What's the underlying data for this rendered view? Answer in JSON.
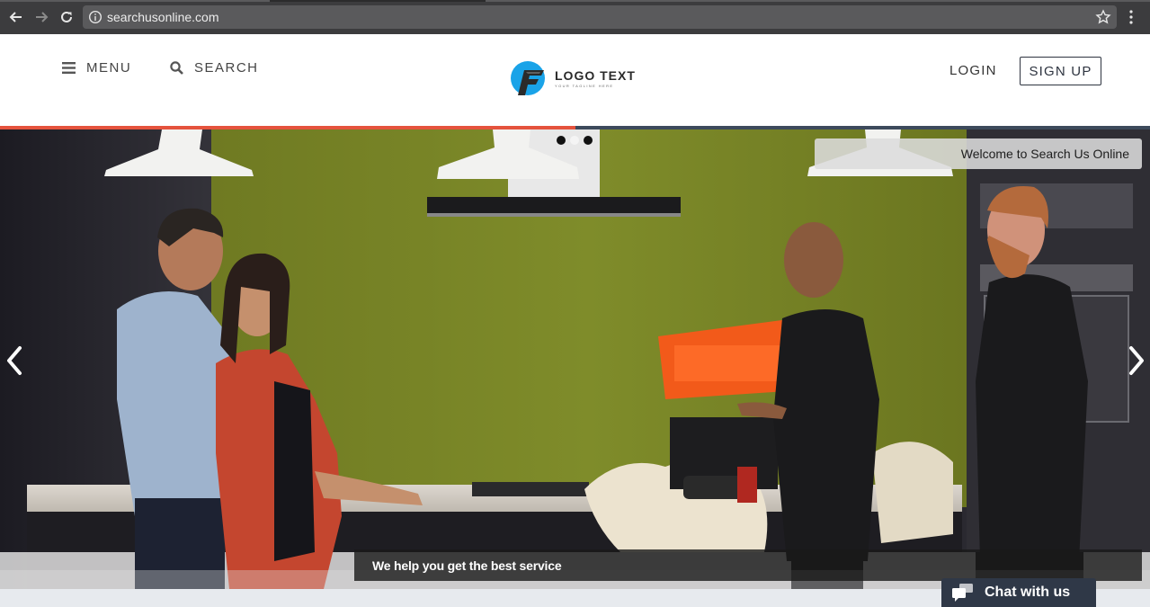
{
  "browser": {
    "url": "searchusonline.com"
  },
  "header": {
    "menu_label": "MENU",
    "search_label": "SEARCH",
    "logo_text": "LOGO TEXT",
    "logo_tagline": "YOUR TAGLINE HERE",
    "login_label": "LOGIN",
    "signup_label": "SIGN UP"
  },
  "hero": {
    "welcome_text": "Welcome to Search Us Online",
    "caption": "We help you get the best service",
    "slides_total": 3,
    "active_slide": 2
  },
  "chat": {
    "label": "Chat with us"
  },
  "colors": {
    "accent_red": "#e5533d",
    "accent_slate": "#3d4a5c",
    "logo_blue": "#1aa3e8",
    "chat_bg": "#2f3847"
  },
  "icons": {
    "menu": "hamburger-icon",
    "search": "magnifier-icon",
    "prev": "chevron-left-icon",
    "next": "chevron-right-icon",
    "chat": "chat-bubbles-icon"
  }
}
